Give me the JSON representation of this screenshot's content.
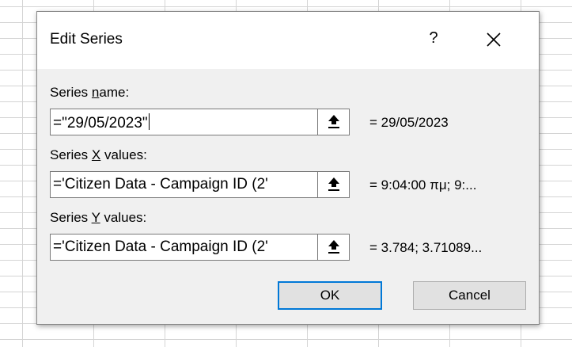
{
  "dialog": {
    "title": "Edit Series",
    "help_label": "?",
    "close_icon": "close-icon",
    "series_name": {
      "label_prefix": "Series ",
      "label_accel": "n",
      "label_suffix": "ame:",
      "value": "=\"29/05/2023\"",
      "preview": "= 29/05/2023"
    },
    "series_x": {
      "label_prefix": "Series ",
      "label_accel": "X",
      "label_suffix": " values:",
      "value": "='Citizen Data - Campaign ID  (2'",
      "preview": "= 9:04:00 πμ; 9:..."
    },
    "series_y": {
      "label_prefix": "Series ",
      "label_accel": "Y",
      "label_suffix": " values:",
      "value": "='Citizen Data - Campaign ID  (2'",
      "preview": "= 3.784; 3.71089..."
    },
    "ok_label": "OK",
    "cancel_label": "Cancel",
    "collapse_icon": "collapse-dialog-icon"
  },
  "colors": {
    "dialog_bg": "#f0f0f0",
    "titlebar_bg": "#ffffff",
    "default_button_border": "#0078d7",
    "button_bg": "#e1e1e1",
    "grid_line": "#d4d4d4"
  }
}
